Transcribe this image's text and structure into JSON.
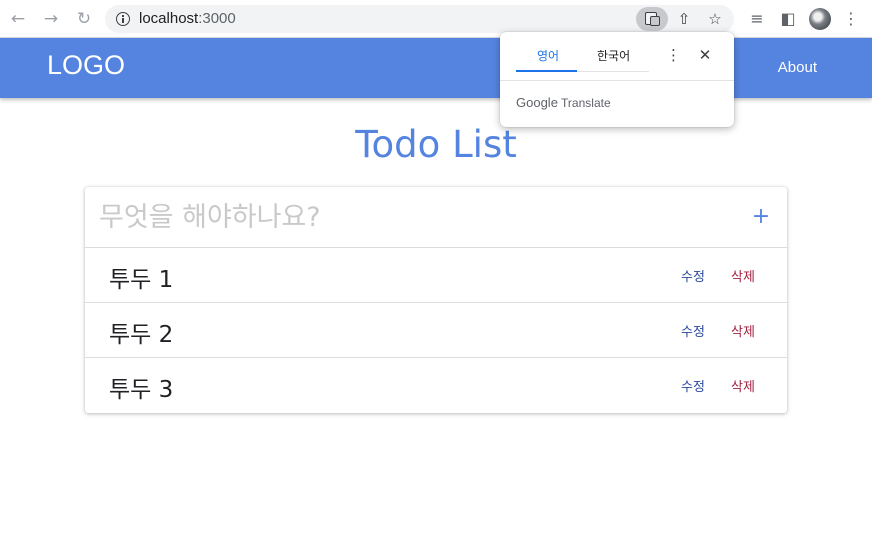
{
  "browser": {
    "url_host": "localhost",
    "url_port": ":3000",
    "icons": {
      "back": "arrow-left-icon",
      "forward": "arrow-right-icon",
      "reload": "reload-icon",
      "site_info": "info-icon",
      "translate": "translate-icon",
      "share": "share-icon",
      "bookmark": "star-icon",
      "reading_list": "reading-list-icon",
      "side_panel": "side-panel-icon",
      "profile": "avatar",
      "menu": "kebab-menu-icon"
    }
  },
  "translate_popup": {
    "tab_source": "영어",
    "tab_target": "한국어",
    "footer_brand": "Google",
    "footer_product": "Translate"
  },
  "header": {
    "logo": "LOGO",
    "nav_about": "About",
    "background_color": "#5584e0"
  },
  "main": {
    "title": "Todo List",
    "input_placeholder": "무엇을 해야하나요?",
    "add_label": "+",
    "todos": [
      {
        "text": "투두 1",
        "edit_label": "수정",
        "delete_label": "삭제"
      },
      {
        "text": "투두 2",
        "edit_label": "수정",
        "delete_label": "삭제"
      },
      {
        "text": "투두 3",
        "edit_label": "수정",
        "delete_label": "삭제"
      }
    ],
    "colors": {
      "accent": "#5584e0",
      "edit": "#2a4a9a",
      "delete": "#a3213f"
    }
  }
}
